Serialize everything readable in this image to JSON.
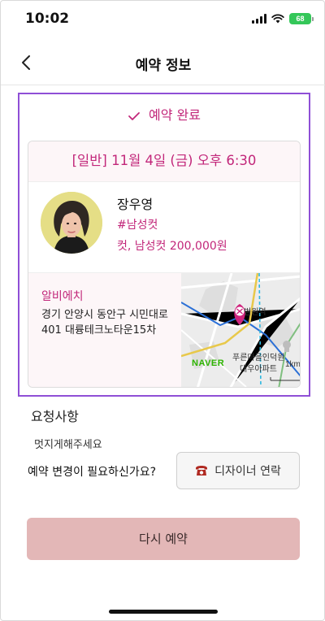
{
  "status_bar": {
    "time": "10:02",
    "battery": "68",
    "icons": [
      "signal-icon",
      "wifi-icon",
      "battery-icon"
    ],
    "battery_color": "#34c759"
  },
  "nav": {
    "title": "예약 정보",
    "back_icon": "chevron-left-icon"
  },
  "reservation": {
    "status": "예약 완료",
    "status_icon": "check-icon",
    "datetime": "[일반] 11월 4일 (금) 오후 6:30",
    "designer": {
      "name": "장우영",
      "tag": "#남성컷",
      "menu": "컷, 남성컷 200,000원"
    },
    "shop": {
      "name": "알비에치",
      "address": "경기 안양시 동안구 시민대로 401 대륭테크노타운15차"
    },
    "map": {
      "provider": "NAVER",
      "labels": {
        "station": "범원역",
        "apartment_line1": "푸른마을인덕원",
        "apartment_line2": "대우아파트",
        "scale": "1km"
      }
    }
  },
  "request": {
    "title": "요청사항",
    "text": "멋지게해주세요"
  },
  "change": {
    "question": "예약 변경이 필요하신가요?",
    "contact_label": "디자이너 연락",
    "contact_icon": "phone-icon"
  },
  "rebook_label": "다시 예약",
  "colors": {
    "accent": "#c2277a",
    "highlight_border": "#8f4fd6",
    "rebook_bg": "#e3b7b7"
  }
}
